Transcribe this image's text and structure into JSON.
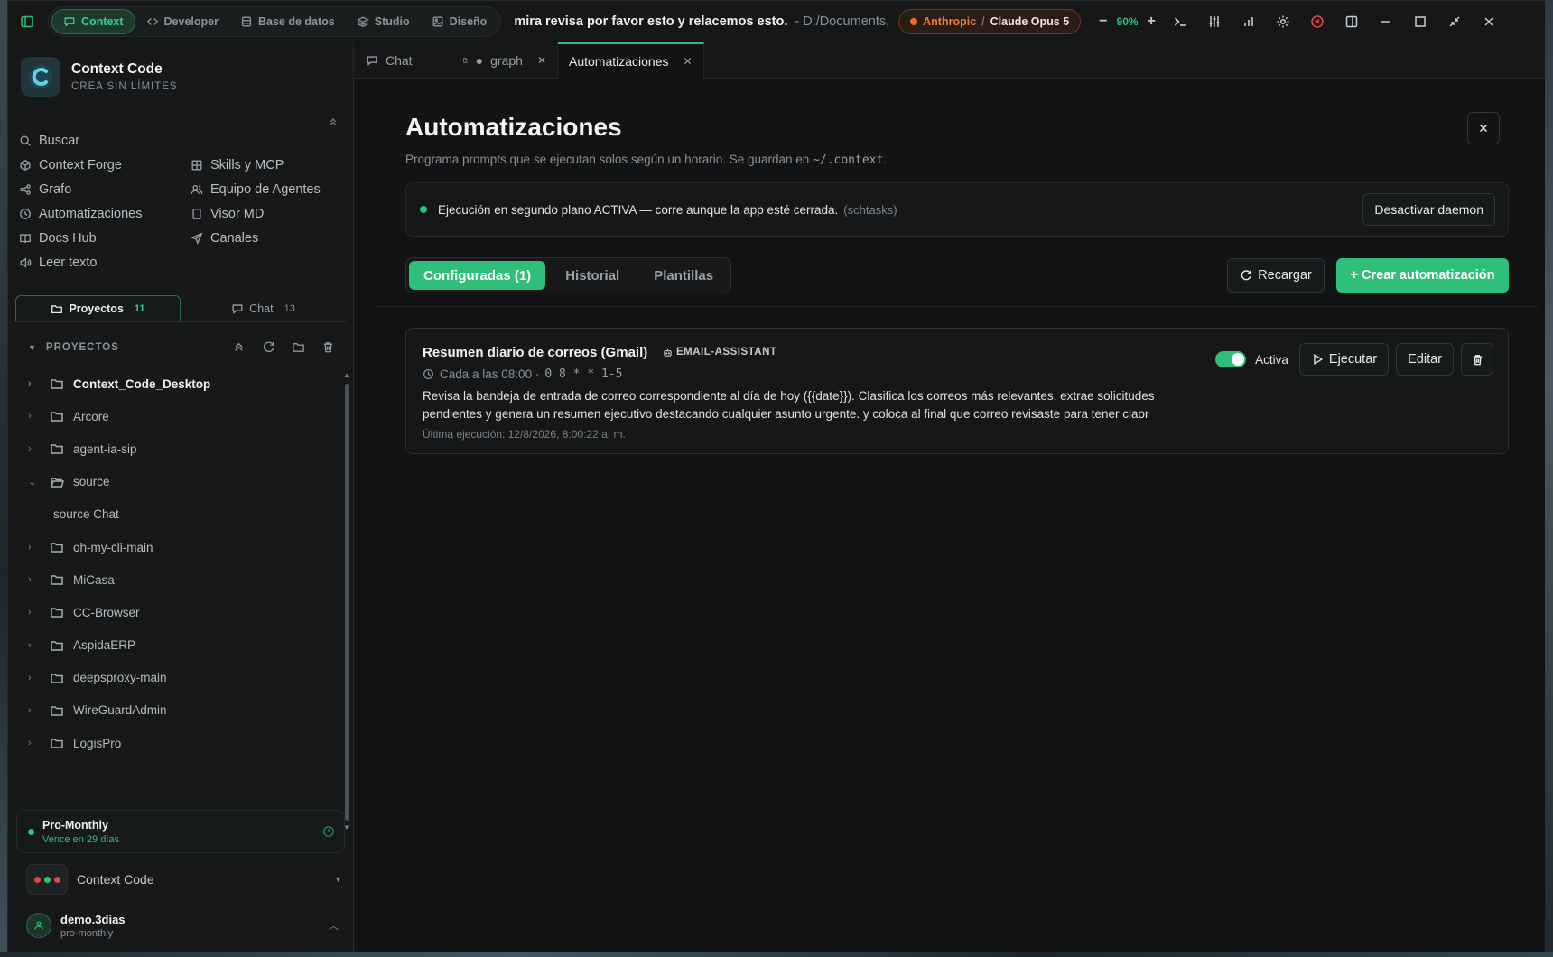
{
  "titlebar": {
    "modes": [
      {
        "label": "Context",
        "icon": "chat-icon",
        "active": true
      },
      {
        "label": "Developer",
        "icon": "code-icon",
        "active": false
      },
      {
        "label": "Base de datos",
        "icon": "database-icon",
        "active": false
      },
      {
        "label": "Studio",
        "icon": "layers-icon",
        "active": false
      },
      {
        "label": "Diseño",
        "icon": "image-icon",
        "active": false
      }
    ],
    "session_title": "mira revisa por favor esto y relacemos esto.",
    "path": "- D:/Documents,",
    "provider": "Anthropic",
    "separator": "/",
    "model": "Claude Opus 5",
    "zoom_minus": "−",
    "zoom": "90%",
    "zoom_plus": "+"
  },
  "sidebar": {
    "brand_name": "Context Code",
    "brand_tagline": "CREA SIN LÍMITES",
    "nav": [
      {
        "label": "Buscar",
        "icon": "search-icon"
      },
      {
        "label": "Context Forge",
        "icon": "box-icon"
      },
      {
        "label": "Skills y MCP",
        "icon": "grid-icon"
      },
      {
        "label": "Grafo",
        "icon": "share-icon"
      },
      {
        "label": "Equipo de Agentes",
        "icon": "users-icon"
      },
      {
        "label": "Automatizaciones",
        "icon": "clock-icon"
      },
      {
        "label": "Visor MD",
        "icon": "file-icon"
      },
      {
        "label": "Docs Hub",
        "icon": "book-icon"
      },
      {
        "label": "Canales",
        "icon": "send-icon"
      },
      {
        "label": "Leer texto",
        "icon": "speaker-icon"
      }
    ],
    "tabs": [
      {
        "label": "Proyectos",
        "count": "11",
        "active": true
      },
      {
        "label": "Chat",
        "count": "13",
        "active": false
      }
    ],
    "projects_header": "PROYECTOS",
    "projects": [
      {
        "label": "Context_Code_Desktop",
        "type": "folder",
        "bold": true
      },
      {
        "label": "Arcore",
        "type": "folder"
      },
      {
        "label": "agent-ia-sip",
        "type": "folder"
      },
      {
        "label": "source",
        "type": "folder-open",
        "expanded": true
      },
      {
        "label": "source Chat",
        "type": "child"
      },
      {
        "label": "oh-my-cli-main",
        "type": "folder"
      },
      {
        "label": "MiCasa",
        "type": "folder"
      },
      {
        "label": "CC-Browser",
        "type": "folder"
      },
      {
        "label": "AspidaERP",
        "type": "folder"
      },
      {
        "label": "deepsproxy-main",
        "type": "folder"
      },
      {
        "label": "WireGuardAdmin",
        "type": "folder"
      },
      {
        "label": "LogisPro",
        "type": "folder"
      }
    ],
    "plan_name": "Pro-Monthly",
    "plan_expiry": "Vence en 29 días",
    "workspace_name": "Context Code",
    "user_name": "demo.3dias",
    "user_plan": "pro-monthly"
  },
  "tabs": [
    {
      "label": "Chat",
      "icon": "chat-icon",
      "active": false,
      "closable": false,
      "modified": false
    },
    {
      "label": "graph",
      "icon": "file-icon",
      "active": false,
      "closable": true,
      "modified": true
    },
    {
      "label": "Automatizaciones",
      "icon": "",
      "active": true,
      "closable": true,
      "modified": false
    }
  ],
  "page": {
    "title": "Automatizaciones",
    "description": "Programa prompts que se ejecutan solos según un horario. Se guardan en",
    "description_path": "~/.context",
    "description_end": ".",
    "daemon_message": "Ejecución en segundo plano ACTIVA — corre aunque la app esté cerrada.",
    "daemon_hint": "(schtasks)",
    "daemon_button": "Desactivar daemon",
    "segments": [
      {
        "label": "Configuradas (1)",
        "active": true
      },
      {
        "label": "Historial",
        "active": false
      },
      {
        "label": "Plantillas",
        "active": false
      }
    ],
    "reload_label": "Recargar",
    "create_label": "+ Crear automatización"
  },
  "automations": [
    {
      "title": "Resumen diario de correos (Gmail)",
      "agent": "EMAIL-ASSISTANT",
      "schedule": "Cada a las 08:00 ·",
      "cron": "0 8 * * 1-5",
      "prompt": "Revisa la bandeja de entrada de correo correspondiente al día de hoy ({{date}}). Clasifica los correos más relevantes, extrae solicitudes pendientes y genera un resumen ejecutivo destacando cualquier asunto urgente. y coloca al final que correo revisaste para tener claor",
      "last_run": "Última ejecución: 12/8/2026, 8:00:22 a. m.",
      "active": true,
      "active_label": "Activa",
      "run_label": "Ejecutar",
      "edit_label": "Editar"
    }
  ],
  "colors": {
    "accent": "#2fbf7a",
    "provider": "#f06a24",
    "danger": "#e0454a",
    "background": "#111314"
  }
}
